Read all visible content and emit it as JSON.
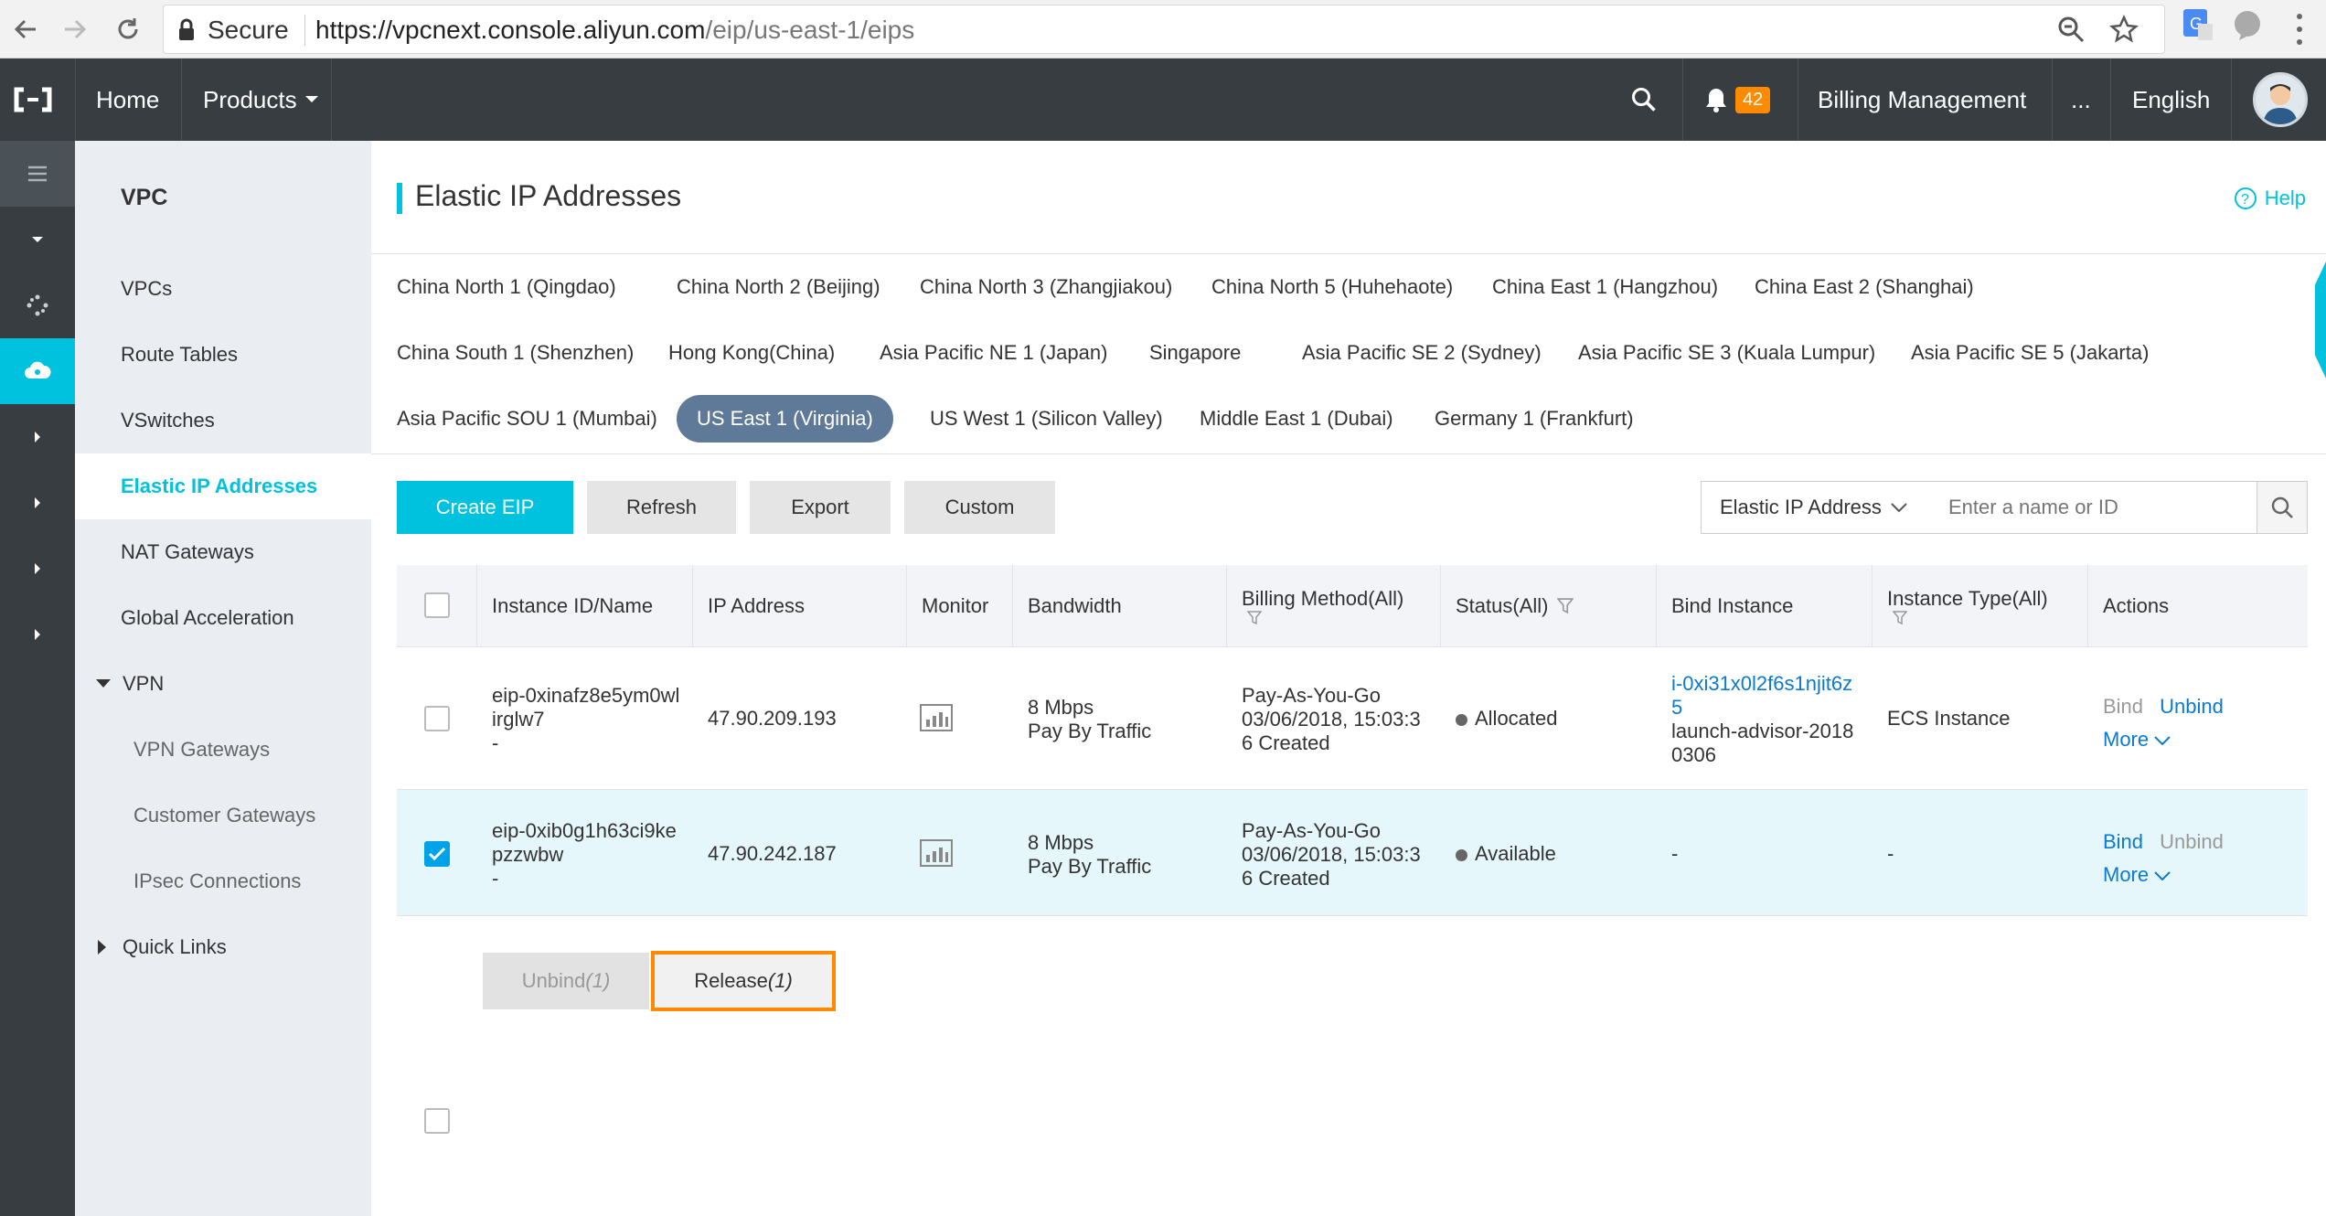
{
  "browser": {
    "secure_label": "Secure",
    "url_host": "https://vpcnext.console.aliyun.com",
    "url_path": "/eip/us-east-1/eips"
  },
  "topbar": {
    "home": "Home",
    "products": "Products",
    "notification_count": "42",
    "billing": "Billing Management",
    "more": "...",
    "language": "English"
  },
  "sidebar": {
    "title": "VPC",
    "items": [
      {
        "label": "VPCs"
      },
      {
        "label": "Route Tables"
      },
      {
        "label": "VSwitches"
      },
      {
        "label": "Elastic IP Addresses"
      },
      {
        "label": "NAT Gateways"
      },
      {
        "label": "Global Acceleration"
      },
      {
        "label": "VPN"
      },
      {
        "label": "VPN Gateways"
      },
      {
        "label": "Customer Gateways"
      },
      {
        "label": "IPsec Connections"
      },
      {
        "label": "Quick Links"
      }
    ]
  },
  "page": {
    "title": "Elastic IP Addresses",
    "help": "Help"
  },
  "regions": [
    "China North 1 (Qingdao)",
    "China North 2 (Beijing)",
    "China North 3 (Zhangjiakou)",
    "China North 5 (Huhehaote)",
    "China East 1 (Hangzhou)",
    "China East 2 (Shanghai)",
    "China South 1 (Shenzhen)",
    "Hong Kong(China)",
    "Asia Pacific NE 1 (Japan)",
    "Singapore",
    "Asia Pacific SE 2 (Sydney)",
    "Asia Pacific SE 3 (Kuala Lumpur)",
    "Asia Pacific SE 5 (Jakarta)",
    "Asia Pacific SOU 1 (Mumbai)",
    "US East 1 (Virginia)",
    "US West 1 (Silicon Valley)",
    "Middle East 1 (Dubai)",
    "Germany 1 (Frankfurt)"
  ],
  "toolbar": {
    "create": "Create EIP",
    "refresh": "Refresh",
    "export": "Export",
    "custom": "Custom",
    "search_type": "Elastic IP Address",
    "search_placeholder": "Enter a name or ID"
  },
  "table": {
    "headers": [
      "Instance ID/Name",
      "IP Address",
      "Monitor",
      "Bandwidth",
      "Billing Method(All)",
      "Status(All)",
      "Bind Instance",
      "Instance Type(All)",
      "Actions"
    ],
    "rows": [
      {
        "id_l1": "eip-0xinafz8e5ym0wl",
        "id_l2": "irglw7",
        "name": "-",
        "ip": "47.90.209.193",
        "bw1": "8 Mbps",
        "bw2": "Pay By Traffic",
        "bill1": "Pay-As-You-Go",
        "bill2": "03/06/2018, 15:03:3",
        "bill3": "6 Created",
        "status": "Allocated",
        "bind1": "i-0xi31x0l2f6s1njit6z",
        "bind2": "5",
        "bind3": "launch-advisor-2018",
        "bind4": "0306",
        "type": "ECS Instance",
        "act_bind": "Bind",
        "act_unbind": "Unbind",
        "act_more": "More",
        "checked": false
      },
      {
        "id_l1": "eip-0xib0g1h63ci9ke",
        "id_l2": "pzzwbw",
        "name": "-",
        "ip": "47.90.242.187",
        "bw1": "8 Mbps",
        "bw2": "Pay By Traffic",
        "bill1": "Pay-As-You-Go",
        "bill2": "03/06/2018, 15:03:3",
        "bill3": "6 Created",
        "status": "Available",
        "bind1": "-",
        "type": "-",
        "act_bind": "Bind",
        "act_unbind": "Unbind",
        "act_more": "More",
        "checked": true
      }
    ]
  },
  "footer": {
    "unbind": "Unbind",
    "unbind_count": "(1)",
    "release": "Release",
    "release_count": "(1)"
  },
  "colors": {
    "accent": "#00c1de",
    "topbar": "#373d41",
    "highlight_border": "#ff8a00",
    "selected_row": "#e6f7fb"
  }
}
